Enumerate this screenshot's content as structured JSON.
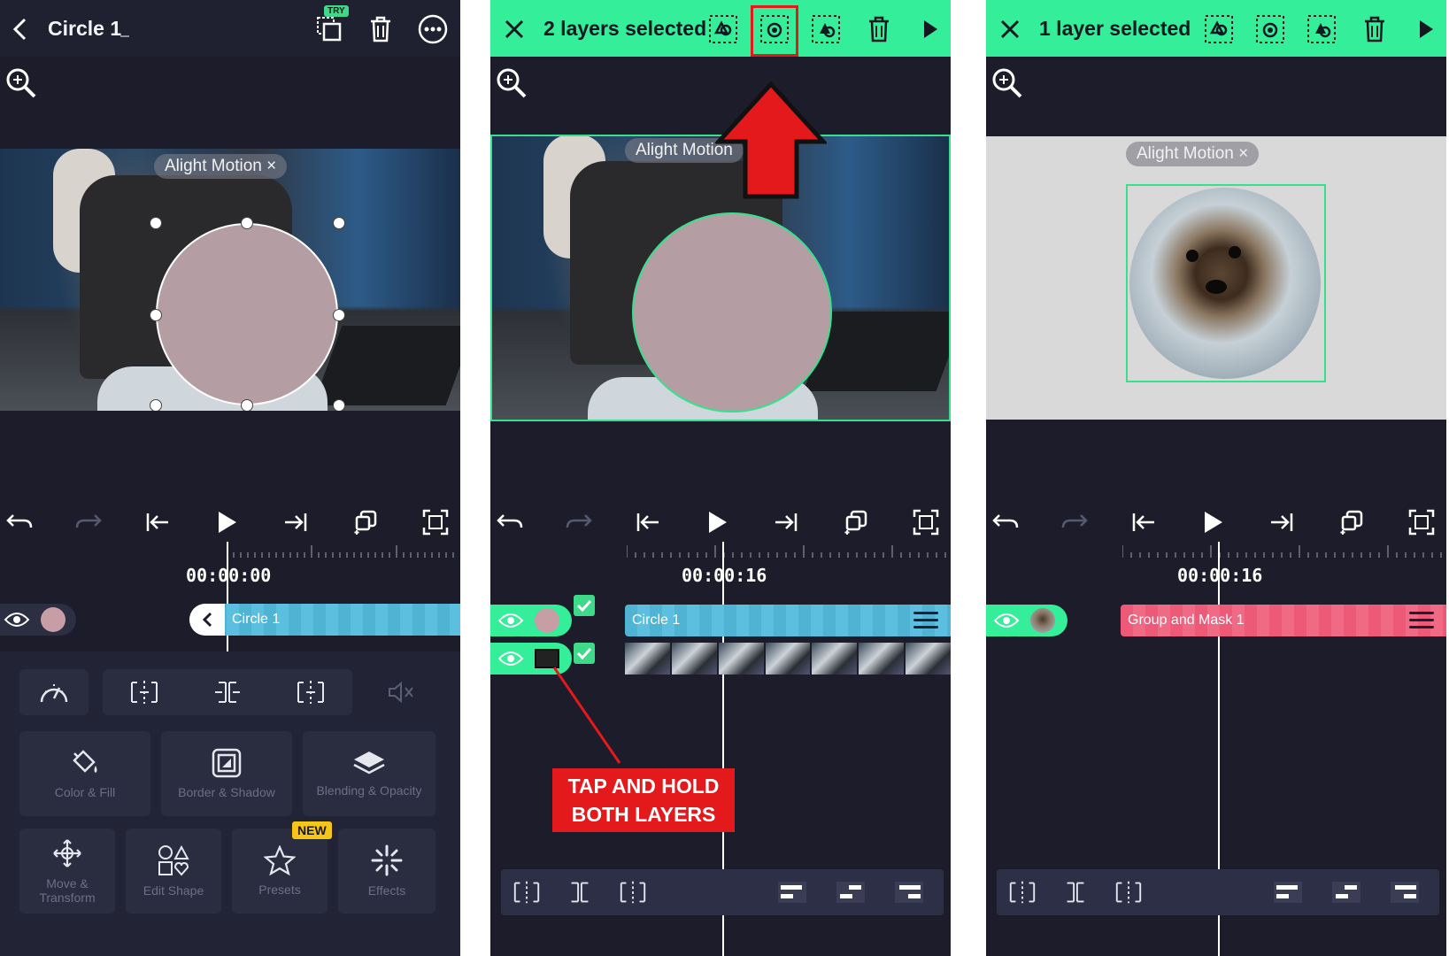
{
  "panels": [
    {
      "header": {
        "title": "Circle 1",
        "try_badge": "TRY"
      },
      "watermark": "Alight Motion ×",
      "timecode": "00:00:00",
      "layer": {
        "name": "Circle 1"
      },
      "tiles": [
        {
          "label": "Color & Fill"
        },
        {
          "label": "Border & Shadow"
        },
        {
          "label": "Blending & Opacity"
        },
        {
          "label": "Move & Transform"
        },
        {
          "label": "Edit Shape"
        },
        {
          "label": "Presets"
        },
        {
          "label": "Effects"
        }
      ],
      "new_badge": "NEW"
    },
    {
      "header": {
        "title": "2 layers selected"
      },
      "watermark": "Alight Motion",
      "timecode": "00:00:16",
      "layers": [
        {
          "name": "Circle 1"
        },
        {
          "name": ""
        }
      ],
      "callout": {
        "line1": "TAP AND HOLD",
        "line2": "BOTH LAYERS"
      }
    },
    {
      "header": {
        "title": "1 layer selected"
      },
      "watermark": "Alight Motion ×",
      "timecode": "00:00:16",
      "layer": {
        "name": "Group and Mask 1"
      }
    }
  ],
  "colors": {
    "bg_dark": "#1c1c2b",
    "header_green": "#34ee9a",
    "circle_fill": "#b49ea3",
    "circle_layer_bar": "#4fb3d3",
    "group_layer_bar": "#ec5a78",
    "annotation_red": "#e3191c",
    "canvas_light": "#d9d9d9"
  }
}
